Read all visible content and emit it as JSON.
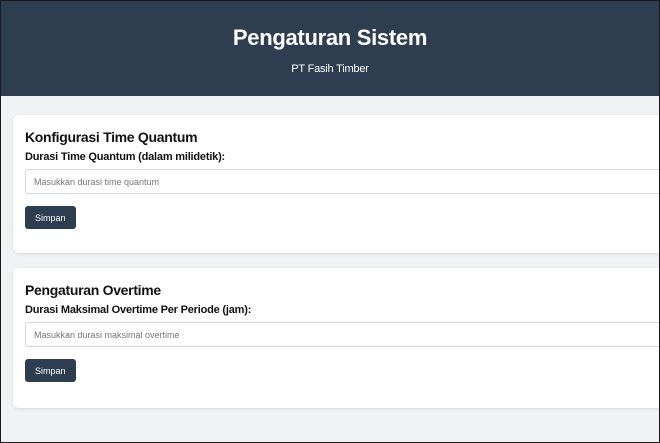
{
  "header": {
    "title": "Pengaturan Sistem",
    "subtitle": "PT Fasih Timber"
  },
  "time_quantum": {
    "title": "Konfigurasi Time Quantum",
    "label": "Durasi Time Quantum (dalam milidetik):",
    "value": "",
    "placeholder": "Masukkan durasi time quantum",
    "save_label": "Simpan"
  },
  "overtime": {
    "title": "Pengaturan Overtime",
    "label": "Durasi Maksimal Overtime Per Periode (jam):",
    "value": "",
    "placeholder": "Masukkan durasi maksimal overtime",
    "save_label": "Simpan"
  },
  "colors": {
    "header_bg": "#2e3e50",
    "page_bg": "#f1f2f4",
    "button_bg": "#2e3e50"
  }
}
